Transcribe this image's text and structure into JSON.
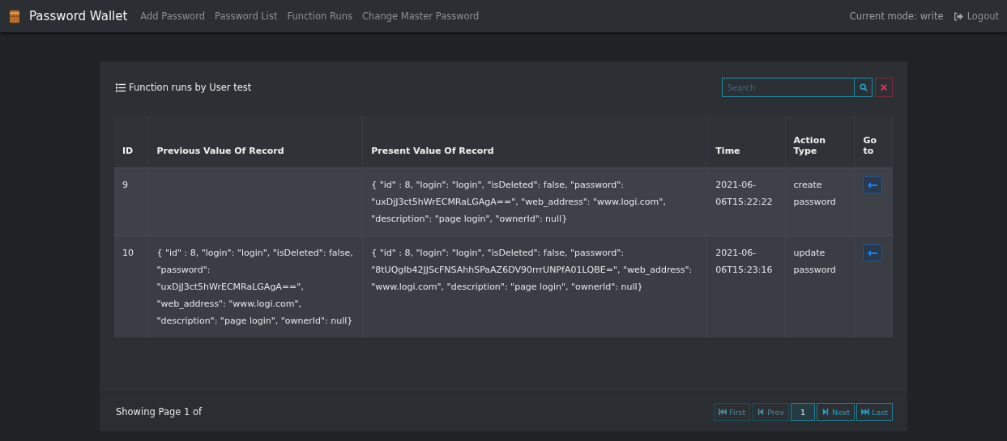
{
  "navbar": {
    "brand": "Password Wallet",
    "links": [
      {
        "label": "Add Password",
        "selected": false
      },
      {
        "label": "Password List",
        "selected": false
      },
      {
        "label": "Function Runs",
        "selected": false
      },
      {
        "label": "Change Master Password",
        "selected": false
      }
    ],
    "mode": "Current mode: write",
    "logout": "Logout"
  },
  "card": {
    "title": "Function runs by User test",
    "search": {
      "placeholder": "Search"
    }
  },
  "table": {
    "columns": [
      "ID",
      "Previous Value Of Record",
      "Present Value Of Record",
      "Time",
      "Action Type",
      "Go to"
    ],
    "rows": [
      {
        "id": "9",
        "previous": "",
        "present": "{ \"id\" : 8, \"login\": \"login\", \"isDeleted\": false, \"password\": \"uxDjJ3ct5hWrECMRaLGAgA==\", \"web_address\": \"www.logi.com\", \"description\": \"page login\", \"ownerId\": null}",
        "time": "2021-06-06T15:22:22",
        "action": "create password"
      },
      {
        "id": "10",
        "previous": "{ \"id\" : 8, \"login\": \"login\", \"isDeleted\": false, \"password\": \"uxDjJ3ct5hWrECMRaLGAgA==\", \"web_address\": \"www.logi.com\", \"description\": \"page login\", \"ownerId\": null}",
        "present": "{ \"id\" : 8, \"login\": \"login\", \"isDeleted\": false, \"password\": \"8tUQgIb42JJScFNSAhhSPaAZ6DV90rrrUNPfA01LQBE=\", \"web_address\": \"www.logi.com\", \"description\": \"page login\", \"ownerId\": null}",
        "time": "2021-06-06T15:23:16",
        "action": "update password"
      }
    ]
  },
  "footer": {
    "info": "Showing Page 1 of",
    "pages": [
      {
        "kind": "first",
        "label": "First",
        "disabled": true,
        "selected": false
      },
      {
        "kind": "prev",
        "label": "Prev",
        "disabled": true,
        "selected": false
      },
      {
        "kind": "page",
        "label": "1",
        "disabled": false,
        "selected": true
      },
      {
        "kind": "next",
        "label": "Next",
        "disabled": false,
        "selected": false
      },
      {
        "kind": "last",
        "label": "Last",
        "disabled": false,
        "selected": false
      }
    ]
  }
}
